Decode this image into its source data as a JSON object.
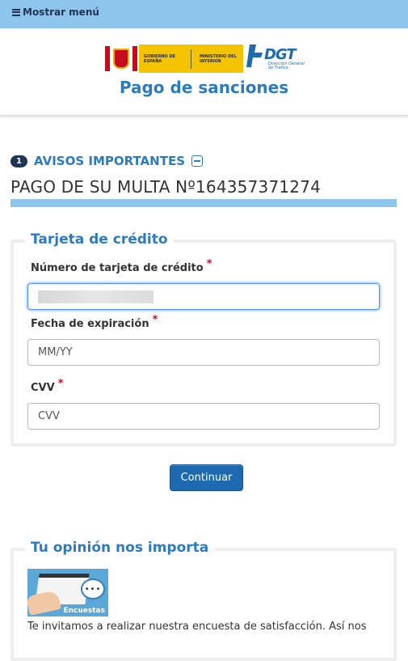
{
  "topbar": {
    "menu_label": "Mostrar menú"
  },
  "header": {
    "gov_logo_text": "GOBIERNO DE ESPAÑA",
    "ministry_text": "MINISTERIO DEL INTERIOR",
    "dgt_logo_text": "DGT",
    "dgt_sub_text": "Dirección General de Tráfico",
    "title": "Pago de sanciones"
  },
  "notices": {
    "count": "1",
    "label": "AVISOS IMPORTANTES"
  },
  "fine": {
    "title": "PAGO DE SU MULTA Nº164357371274"
  },
  "card_form": {
    "legend": "Tarjeta de crédito",
    "required_mark": "*",
    "card_number": {
      "label": "Número de tarjeta de crédito",
      "value": ""
    },
    "expiry": {
      "label": "Fecha de expiración",
      "placeholder": "MM/YY"
    },
    "cvv": {
      "label": "CVV",
      "placeholder": "CVV"
    }
  },
  "submit_label": "Continuar",
  "survey": {
    "legend": "Tu opinión nos importa",
    "image_caption": "Encuestas",
    "text": "Te invitamos a realizar nuestra encuesta de satisfacción. Así nos"
  },
  "colors": {
    "accent": "#2b7bc0",
    "topbar": "#8ec5ec",
    "button": "#1d6ab1",
    "required": "#c8102e"
  }
}
